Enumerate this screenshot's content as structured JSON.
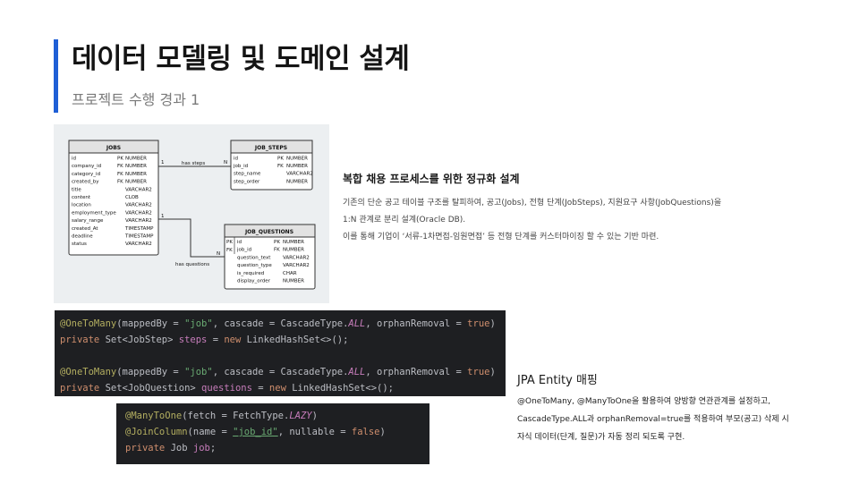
{
  "header": {
    "title": "데이터 모델링 및 도메인 설계",
    "subtitle": "프로젝트 수행 경과 1"
  },
  "erd": {
    "jobs": {
      "title": "JOBS",
      "rows": [
        [
          "id",
          "PK",
          "NUMBER"
        ],
        [
          "company_id",
          "FK",
          "NUMBER"
        ],
        [
          "category_id",
          "FK",
          "NUMBER"
        ],
        [
          "created_by",
          "FK",
          "NUMBER"
        ],
        [
          "title",
          "",
          "VARCHAR2"
        ],
        [
          "content",
          "",
          "CLOB"
        ],
        [
          "location",
          "",
          "VARCHAR2"
        ],
        [
          "employment_type",
          "",
          "VARCHAR2"
        ],
        [
          "salary_range",
          "",
          "VARCHAR2"
        ],
        [
          "created_At",
          "",
          "TIMESTAMP"
        ],
        [
          "deadline",
          "",
          "TIMESTAMP"
        ],
        [
          "status",
          "",
          "VARCHAR2"
        ]
      ]
    },
    "job_steps": {
      "title": "JOB_STEPS",
      "rows": [
        [
          "id",
          "PK",
          "NUMBER"
        ],
        [
          "job_id",
          "FK",
          "NUMBER"
        ],
        [
          "step_name",
          "",
          "VARCHAR2"
        ],
        [
          "step_order",
          "",
          "NUMBER"
        ]
      ]
    },
    "job_questions": {
      "title": "JOB_QUESTIONS",
      "keys": [
        "PK",
        "FK"
      ],
      "rows": [
        [
          "id",
          "PK",
          "NUMBER"
        ],
        [
          "job_id",
          "FK",
          "NUMBER"
        ],
        [
          "question_text",
          "",
          "VARCHAR2"
        ],
        [
          "question_type",
          "",
          "VARCHAR2"
        ],
        [
          "is_required",
          "",
          "CHAR"
        ],
        [
          "display_order",
          "",
          "NUMBER"
        ]
      ]
    },
    "rel1": {
      "label": "has steps",
      "one": "1",
      "many": "N"
    },
    "rel2": {
      "label": "has questions",
      "one": "1",
      "many": "N"
    }
  },
  "section1": {
    "heading": "복합 채용 프로세스를 위한 정규화 설계",
    "line1": "기존의 단순 공고 테이블 구조를 탈피하여, 공고(Jobs), 전형 단계(JobSteps), 지원요구 사항(JobQuestions)을",
    "line2": "1:N 관계로 분리 설계(Oracle DB).",
    "line3": "이를 통해 기업이 ‘서류-1차면접-임원면접’ 등 전형 단계를 커스터마이징 할 수 있는 기반 마련."
  },
  "section2": {
    "heading": "JPA Entity 매핑",
    "line1": "@OneToMany, @ManyToOne을 활용하여 양방향 연관관계를 설정하고,",
    "line2": "CascadeType.ALL과 orphanRemoval=true를 적용하여 부모(공고) 삭제 시",
    "line3": "자식 데이터(단계, 질문)가 자동 정리 되도록 구현."
  },
  "code1": {
    "a1": "@OneToMany",
    "a2": "(mappedBy = ",
    "a3": "\"job\"",
    "a4": ", cascade = CascadeType.",
    "a5": "ALL",
    "a6": ", orphanRemoval = ",
    "a7": "true",
    "a8": ")",
    "b1": "private ",
    "b2": "Set<JobStep> ",
    "b3": "steps",
    "b4": " = ",
    "b5": "new ",
    "b6": "LinkedHashSet<>();",
    "c1": "@OneToMany",
    "c2": "(mappedBy = ",
    "c3": "\"job\"",
    "c4": ", cascade = CascadeType.",
    "c5": "ALL",
    "c6": ", orphanRemoval = ",
    "c7": "true",
    "c8": ")",
    "d1": "private ",
    "d2": "Set<JobQuestion> ",
    "d3": "questions",
    "d4": " = ",
    "d5": "new ",
    "d6": "LinkedHashSet<>();"
  },
  "code2": {
    "a1": "@ManyToOne",
    "a2": "(fetch = FetchType.",
    "a3": "LAZY",
    "a4": ")",
    "b1": "@JoinColumn",
    "b2": "(name = ",
    "b3": "\"job_id\"",
    "b4": ", nullable = ",
    "b5": "false",
    "b6": ")",
    "c1": "private ",
    "c2": "Job ",
    "c3": "job",
    "c4": ";"
  },
  "colors": {
    "accent": "#1f5fd6",
    "code_bg": "#1e1f22",
    "annotation": "#b3ae60",
    "keyword": "#cf8e6d",
    "string": "#6aab73",
    "field": "#c77dbb"
  }
}
